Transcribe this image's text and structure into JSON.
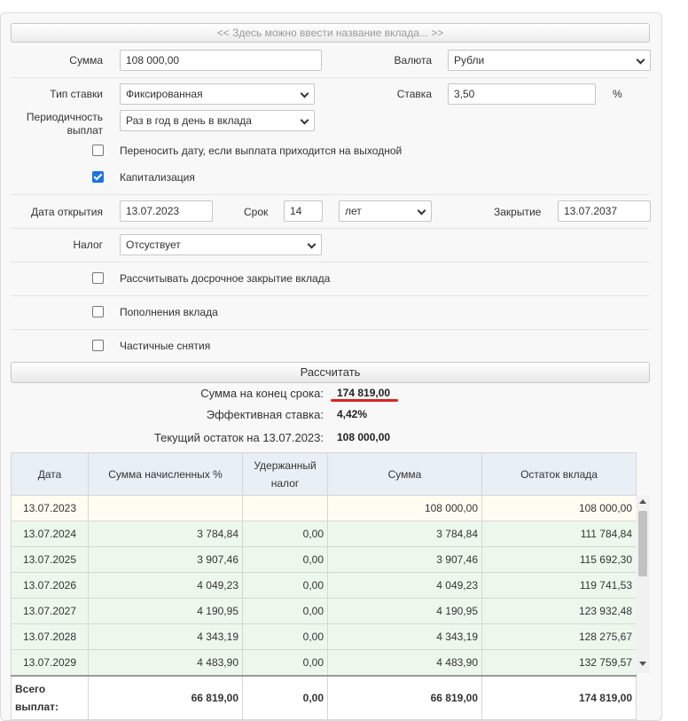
{
  "deposit_name_placeholder": "<< Здесь можно ввести название вклада... >>",
  "form": {
    "amount_label": "Сумма",
    "amount_value": "108 000,00",
    "currency_label": "Валюта",
    "currency_value": "Рубли",
    "rate_type_label": "Тип ставки",
    "rate_type_value": "Фиксированная",
    "rate_label": "Ставка",
    "rate_value": "3,50",
    "rate_unit": "%",
    "periodicity_label": "Периодичность выплат",
    "periodicity_value": "Раз в год в день в вклада",
    "weekend_shift_label": "Переносить дату, если выплата приходится на выходной",
    "weekend_shift_checked": false,
    "capitalization_label": "Капитализация",
    "capitalization_checked": true,
    "open_date_label": "Дата открытия",
    "open_date_value": "13.07.2023",
    "term_label": "Срок",
    "term_value": "14",
    "term_unit_value": "лет",
    "close_label": "Закрытие",
    "close_value": "13.07.2037",
    "tax_label": "Налог",
    "tax_value": "Отсуствует",
    "early_close_label": "Рассчитывать досрочное закрытие вклада",
    "early_close_checked": false,
    "topup_label": "Пополнения вклада",
    "topup_checked": false,
    "partial_withdraw_label": "Частичные снятия",
    "partial_withdraw_checked": false,
    "calculate_label": "Рассчитать"
  },
  "results": {
    "end_sum_label": "Сумма на конец срока:",
    "end_sum_value": "174 819,00",
    "effective_rate_label": "Эффективная ставка:",
    "effective_rate_value": "4,42%",
    "current_balance_label": "Текущий остаток на 13.07.2023:",
    "current_balance_value": "108 000,00"
  },
  "table": {
    "headers": {
      "date": "Дата",
      "accrued": "Сумма начисленных %",
      "tax": "Удержанный налог",
      "sum": "Сумма",
      "balance": "Остаток вклада"
    },
    "rows": [
      {
        "date": "13.07.2023",
        "accrued": "",
        "tax": "",
        "sum": "108 000,00",
        "balance": "108 000,00"
      },
      {
        "date": "13.07.2024",
        "accrued": "3 784,84",
        "tax": "0,00",
        "sum": "3 784,84",
        "balance": "111 784,84"
      },
      {
        "date": "13.07.2025",
        "accrued": "3 907,46",
        "tax": "0,00",
        "sum": "3 907,46",
        "balance": "115 692,30"
      },
      {
        "date": "13.07.2026",
        "accrued": "4 049,23",
        "tax": "0,00",
        "sum": "4 049,23",
        "balance": "119 741,53"
      },
      {
        "date": "13.07.2027",
        "accrued": "4 190,95",
        "tax": "0,00",
        "sum": "4 190,95",
        "balance": "123 932,48"
      },
      {
        "date": "13.07.2028",
        "accrued": "4 343,19",
        "tax": "0,00",
        "sum": "4 343,19",
        "balance": "128 275,67"
      },
      {
        "date": "13.07.2029",
        "accrued": "4 483,90",
        "tax": "0,00",
        "sum": "4 483,90",
        "balance": "132 759,57"
      }
    ],
    "total": {
      "label": "Всего выплат:",
      "accrued": "66 819,00",
      "tax": "0,00",
      "sum": "66 819,00",
      "balance": "174 819,00"
    }
  },
  "colors": {
    "checkbox_checked": "#1a73e8",
    "underline": "#e02020",
    "row_first_bg": "#fffdf2",
    "row_bg": "#edf8ed",
    "header_bg": "#e8eff5"
  }
}
